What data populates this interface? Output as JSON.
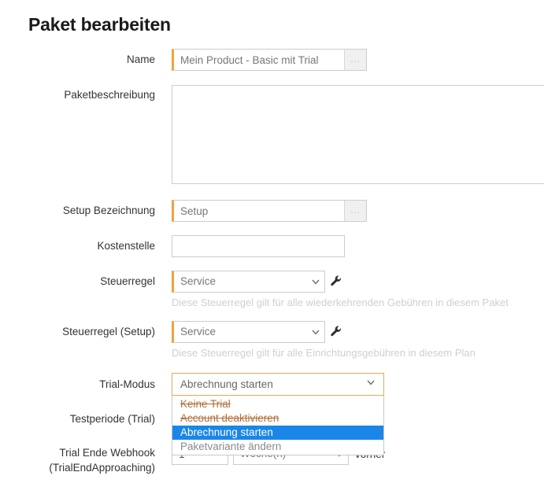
{
  "page": {
    "title": "Paket bearbeiten"
  },
  "fields": {
    "name": {
      "label": "Name",
      "value": "Mein Product - Basic mit Trial",
      "dots_label": "..."
    },
    "description": {
      "label": "Paketbeschreibung",
      "value": ""
    },
    "setup_label_field": {
      "label": "Setup Bezeichnung",
      "value": "Setup",
      "dots_label": "..."
    },
    "cost_center": {
      "label": "Kostenstelle",
      "value": ""
    },
    "tax_rule": {
      "label": "Steuerregel",
      "value": "Service",
      "helper": "Diese Steuerregel gilt für alle wiederkehrenden Gebühren in diesem Paket"
    },
    "tax_rule_setup": {
      "label": "Steuerregel (Setup)",
      "value": "Service",
      "helper": "Diese Steuerregel gilt für alle Einrichtungsgebühren in diesem Plan"
    },
    "trial_mode": {
      "label": "Trial-Modus",
      "value": "Abrechnung starten",
      "options": [
        {
          "label": "Keine Trial",
          "state": "disabled"
        },
        {
          "label": "Account deaktivieren",
          "state": "disabled"
        },
        {
          "label": "Abrechnung starten",
          "state": "selected"
        },
        {
          "label": "Paketvariante ändern",
          "state": "normal"
        }
      ]
    },
    "trial_period": {
      "label": "Testperiode (Trial)"
    },
    "trial_end_webhook": {
      "label_line1": "Trial Ende Webhook",
      "label_line2": "(TrialEndApproaching)",
      "amount": "1",
      "unit": "Woche(n)",
      "suffix": "vorher"
    }
  },
  "colors": {
    "accent_orange": "#f0a33c",
    "focus_border": "#e0a95c",
    "selected_blue": "#1a86e8",
    "disabled_option": "#b0703c",
    "helper_gray": "#cfcfcf"
  },
  "icons": {
    "wrench": "wrench-icon",
    "chevron": "chevron-down-icon"
  }
}
